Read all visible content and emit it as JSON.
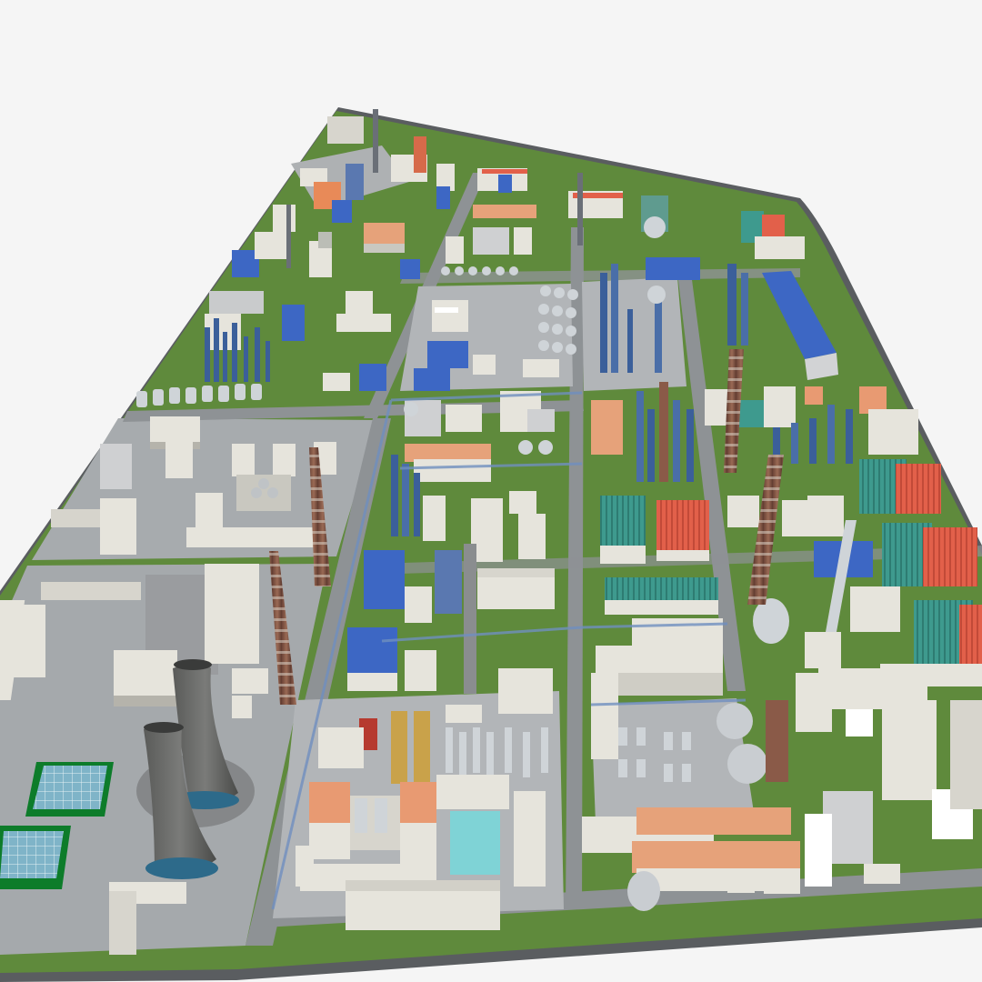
{
  "scene": {
    "subject": "industrial-plant-3d-model",
    "colors": {
      "background": "#f5f5f5",
      "ground_edge": "#5a5d60",
      "paving": "#a7abae",
      "paving_light": "#b9bcbf",
      "grass": "#5f8a3c",
      "grass_dark": "#3f6b2a",
      "road": "#8e9295",
      "building_white": "#e6e4dc",
      "building_shadow": "#b5b3ab",
      "roof_blue": "#3d67c4",
      "roof_teal": "#3e9a8e",
      "roof_red": "#e2604a",
      "roof_orange": "#e89a72",
      "chimney_brick": "#8a5a48",
      "cooling_tower": "#6e6f6d",
      "tank_silver": "#cfd4d8",
      "pipe_blue": "#2f4f8f",
      "solar_panel": "#7fb4c8",
      "pool": "#7fd3d6"
    }
  }
}
